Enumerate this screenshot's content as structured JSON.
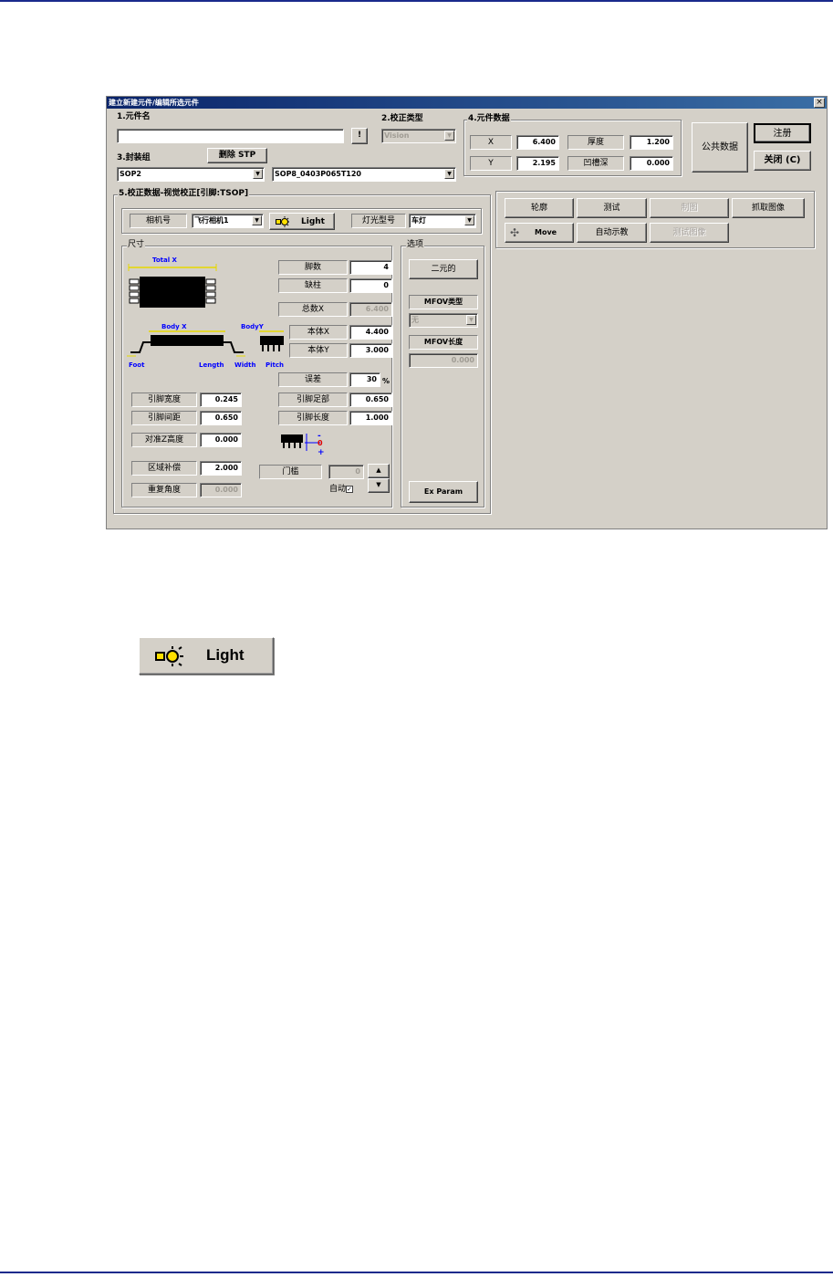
{
  "window": {
    "title": "建立新建元件/编辑所选元件",
    "close_label": "×"
  },
  "section1": {
    "label": "1.元件名",
    "name_value": "",
    "info_button": "!"
  },
  "section2": {
    "label": "2.校正类型",
    "type_value": "Vision"
  },
  "section3": {
    "label": "3.封装组",
    "delete_button": "删除  STP",
    "package_value": "SOP2",
    "package_name_value": "SOP8_0403P065T120"
  },
  "section4": {
    "label": "4.元件数据",
    "x_label": "X",
    "x_value": "6.400",
    "y_label": "Y",
    "y_value": "2.195",
    "thickness_label": "厚度",
    "thickness_value": "1.200",
    "groove_label": "凹槽深",
    "groove_value": "0.000"
  },
  "top_buttons": {
    "common_data": "公共数据",
    "register": "注册",
    "close": "关闭 (C)"
  },
  "section5": {
    "label": "5.校正数据-视觉校正[引脚:TSOP]",
    "camera_label": "相机号",
    "camera_value": "飞行相机1",
    "light_button": "Light",
    "light_type_label": "灯光型号",
    "light_type_value": "车灯",
    "dim_group": "尺寸",
    "diagram": {
      "total_x": "Total X",
      "body_x": "Body X",
      "body_y": "BodyY",
      "foot": "Foot",
      "length": "Length",
      "width": "Width",
      "pitch": "Pitch"
    },
    "lead_count_label": "脚数",
    "lead_count_value": "4",
    "missing_label": "缺柱",
    "missing_value": "0",
    "total_x_label": "总数X",
    "total_x_value": "6.400",
    "body_x_label": "本体X",
    "body_x_value": "4.400",
    "body_y_label": "本体Y",
    "body_y_value": "3.000",
    "tolerance_label": "误差",
    "tolerance_value": "30",
    "tolerance_unit": "%",
    "lead_width_label": "引脚宽度",
    "lead_width_value": "0.245",
    "lead_pitch_label": "引脚间距",
    "lead_pitch_value": "0.650",
    "foot_label": "引脚足部",
    "foot_value": "0.650",
    "lead_length_label": "引脚长度",
    "lead_length_value": "1.000",
    "align_z_label": "对准Z高度",
    "align_z_value": "0.000",
    "zone_comp_label": "区域补偿",
    "zone_comp_value": "2.000",
    "repeat_angle_label": "重复角度",
    "repeat_angle_value": "0.000",
    "threshold_label": "门槛",
    "threshold_value": "0",
    "auto_label": "自动",
    "options_group": "选项",
    "binary_button": "二元的",
    "mfov_type_label": "MFOV类型",
    "mfov_type_value": "无",
    "mfov_length_label": "MFOV长度",
    "mfov_length_value": "0.000",
    "ex_param_button": "Ex Param",
    "z_diag": {
      "minus": "-",
      "zero": "0",
      "plus": "+"
    }
  },
  "action_panel": {
    "contour": "轮廓",
    "test": "测试",
    "drawing": "制图",
    "capture": "抓取图像",
    "move": "Move",
    "auto_teach": "自动示教",
    "test_image": "测试图像"
  },
  "enlarged": {
    "light_button": "Light"
  }
}
